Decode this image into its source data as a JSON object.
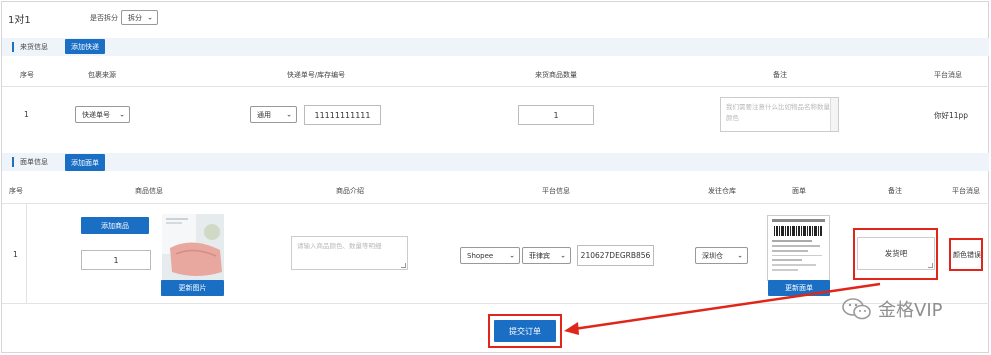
{
  "header": {
    "title": "1对1",
    "split_label": "是否拆分",
    "split_value": "拆分"
  },
  "incoming": {
    "section_label": "来货信息",
    "add_button": "添加快递",
    "columns": [
      "序号",
      "包裹来源",
      "快递单号/库存编号",
      "来货商品数量",
      "备注",
      "平台消息"
    ],
    "row": {
      "index": "1",
      "source_select": "快递单号",
      "carrier_select": "通用",
      "tracking_no": "11111111111",
      "quantity": "1",
      "remark_placeholder": "我们需要注意什么比如物品名称数量颜色",
      "platform_msg": "你好11pp"
    }
  },
  "waybill": {
    "section_label": "面单信息",
    "add_button": "添加面单",
    "columns": [
      "序号",
      "商品信息",
      "商品介绍",
      "平台信息",
      "发往仓库",
      "面单",
      "备注",
      "平台消息"
    ],
    "row": {
      "index": "1",
      "add_product_button": "添加商品",
      "qty": "1",
      "update_image_button": "更新图片",
      "intro_placeholder": "请输入商品颜色、数量等明细",
      "platform_select": "Shopee",
      "store_select": "菲律宾",
      "order_no": "210627DEGRB856",
      "warehouse_select": "深圳仓",
      "update_waybill_button": "更新面单",
      "remark": "发货吧",
      "platform_msg": "颜色错误"
    }
  },
  "submit_button": "提交订单",
  "watermark": "金格VIP",
  "colors": {
    "primary": "#1a6fc4",
    "highlight": "#e0261b",
    "section_bg": "#eef4fa"
  }
}
